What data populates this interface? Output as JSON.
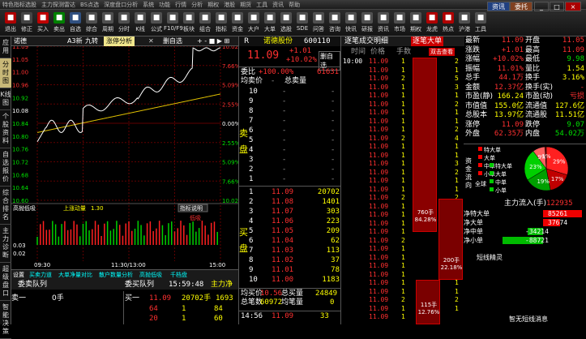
{
  "menu": [
    "特色指标选股",
    "主力探测雷达",
    "BS点选",
    "深度盘口分析",
    "系统",
    "功能",
    "行情",
    "分析",
    "期权",
    "港股",
    "期货",
    "工具",
    "资讯",
    "帮助"
  ],
  "toolbar": [
    {
      "label": "退出",
      "color": "#b00000"
    },
    {
      "label": "修正",
      "color": "#444"
    },
    {
      "label": "买入",
      "color": "#c00000"
    },
    {
      "label": "卖出",
      "color": "#008000"
    },
    {
      "label": "自选",
      "color": "#305080"
    },
    {
      "label": "综合",
      "color": "#505050"
    },
    {
      "label": "周期",
      "color": "#505050"
    },
    {
      "label": "分时",
      "color": "#505050"
    },
    {
      "label": "K线",
      "color": "#505050"
    },
    {
      "label": "公式",
      "color": "#505050"
    },
    {
      "label": "F10/F9",
      "color": "#505050"
    },
    {
      "label": "板块",
      "color": "#505050"
    },
    {
      "label": "组合",
      "color": "#505050"
    },
    {
      "label": "指标",
      "color": "#505050"
    },
    {
      "label": "资金",
      "color": "#505050"
    },
    {
      "label": "大户",
      "color": "#505050"
    },
    {
      "label": "大单",
      "color": "#505050"
    },
    {
      "label": "选股",
      "color": "#505050"
    },
    {
      "label": "SDE",
      "color": "#505050"
    },
    {
      "label": "问答",
      "color": "#505050"
    },
    {
      "label": "咨询",
      "color": "#505050"
    },
    {
      "label": "快讯",
      "color": "#505050"
    },
    {
      "label": "研报",
      "color": "#505050"
    },
    {
      "label": "资讯",
      "color": "#505050"
    },
    {
      "label": "市场",
      "color": "#505050"
    },
    {
      "label": "期权",
      "color": "#505050"
    },
    {
      "label": "龙虎",
      "color": "#b00000"
    },
    {
      "label": "热点",
      "color": "#b00000"
    },
    {
      "label": "沪港",
      "color": "#505050"
    },
    {
      "label": "工具",
      "color": "#505050"
    }
  ],
  "window": {
    "account": "资讯",
    "user": "委托",
    "min": "_",
    "max": "□",
    "close": "×"
  },
  "sidebar": [
    "应用",
    "分时图",
    "K线图",
    "个股资料",
    "自选报价",
    "综合排名",
    "主力诊断",
    "超级盘口",
    "智能决策"
  ],
  "chart_tabs": {
    "code": "诺德",
    "a": "A3新",
    "b": "九转",
    "active": "涨停分析",
    "close": "✕",
    "custom": "删自选",
    "controls": "+ - ■ ▶ ⊞"
  },
  "price_chart": {
    "left_ticks": [
      "11.09",
      "11.05",
      "11.00",
      "10.96",
      "10.92",
      "10.08",
      "10.84",
      "10.80",
      "10.76",
      "10.72",
      "10.68",
      "10.64",
      "10.60"
    ],
    "right_ticks": [
      "10.02%",
      "7.66%",
      "5.09%",
      "2.55%",
      "0.00%",
      "2.55%",
      "5.09%",
      "7.66%",
      "10.02%"
    ]
  },
  "indicator": {
    "title": "高抛低吸",
    "sub": "上涨动量",
    "value": "1.30",
    "btn": "指标说明",
    "mark": "低吸",
    "bottom_marks": [
      "0.03",
      "0.02"
    ]
  },
  "time_axis": [
    "09:30",
    "11:30/13:00",
    "15:00"
  ],
  "bottom_tabs": [
    "设置",
    "买卖力道",
    "大单净量对比",
    "散户数量分析",
    "高抛低吸",
    "千档盘"
  ],
  "queue": {
    "tab1": "委卖队列",
    "tab2": "委买队列",
    "time": "15:59:48",
    "right": "主力净",
    "left_label": "卖一",
    "left_value": "0手",
    "buy1_label": "买一",
    "buy1_price": "11.09",
    "buy1_vol": "20702手",
    "buy1_count": "1693",
    "rows": [
      [
        "64",
        "1",
        "84"
      ],
      [
        "20",
        "1",
        "60"
      ]
    ]
  },
  "quote": {
    "code": "R",
    "name": "诺德股份",
    "id": "600110",
    "price": "11.09",
    "change": "+1.01",
    "pct": "+10.02%",
    "btn": "删自选",
    "weibi_label": "委比",
    "weibi": "+100.00%",
    "weicha": "61631",
    "jun_label": "均卖价",
    "total_label": "总卖量",
    "sell": [
      [
        "10",
        "-",
        "-"
      ],
      [
        "9",
        "-",
        "-"
      ],
      [
        "8",
        "-",
        "-"
      ],
      [
        "7",
        "-",
        "-"
      ],
      [
        "6",
        "-",
        "-"
      ],
      [
        "5",
        "-",
        "-"
      ],
      [
        "4",
        "-",
        "-"
      ],
      [
        "3",
        "-",
        "-"
      ],
      [
        "2",
        "-",
        "-"
      ],
      [
        "1",
        "-",
        "-"
      ]
    ],
    "buy": [
      [
        "1",
        "11.09",
        "20702"
      ],
      [
        "2",
        "11.08",
        "1401"
      ],
      [
        "3",
        "11.07",
        "303"
      ],
      [
        "4",
        "11.06",
        "223"
      ],
      [
        "5",
        "11.05",
        "209"
      ],
      [
        "6",
        "11.04",
        "62"
      ],
      [
        "7",
        "11.03",
        "113"
      ],
      [
        "8",
        "11.02",
        "37"
      ],
      [
        "9",
        "11.01",
        "78"
      ],
      [
        "10",
        "11.00",
        "1183"
      ]
    ],
    "sell_side": "卖盘",
    "buy_side": "买盘",
    "avg_buy_label": "均买价",
    "avg_buy": "10.56",
    "total_buy_label": "总买量",
    "total_buy": "24849",
    "total_pen_label": "总笔数",
    "total_pen": "60972",
    "avg_pen_label": "均笔量",
    "avg_pen": "0",
    "tick_time": "14:56",
    "tick_price": "11.09",
    "tick_vol": "33"
  },
  "tape": {
    "tab1": "逐笔成交明细",
    "tab2": "逐笔大单",
    "cols": [
      "时间",
      "价格",
      "手数"
    ],
    "rows": [
      [
        "10:00",
        "11.09",
        "1"
      ],
      [
        "",
        "11.09",
        "1"
      ],
      [
        "",
        "11.09",
        "2"
      ],
      [
        "",
        "11.09",
        "1"
      ],
      [
        "",
        "11.09",
        "1"
      ],
      [
        "",
        "11.09",
        "1"
      ],
      [
        "",
        "11.09",
        "1"
      ],
      [
        "",
        "11.09",
        "1"
      ],
      [
        "",
        "11.09",
        "1"
      ],
      [
        "",
        "11.09",
        "2"
      ],
      [
        "",
        "11.09",
        "1"
      ],
      [
        "",
        "11.09",
        "1"
      ],
      [
        "",
        "11.09",
        "1"
      ],
      [
        "",
        "11.09",
        "1"
      ],
      [
        "",
        "11.09",
        "1"
      ],
      [
        "",
        "11.09",
        "1"
      ],
      [
        "",
        "11.09",
        "2"
      ],
      [
        "",
        "11.09",
        "1"
      ],
      [
        "",
        "11.09",
        "1"
      ],
      [
        "",
        "11.09",
        "1"
      ],
      [
        "",
        "11.09",
        "1"
      ],
      [
        "",
        "11.09",
        "2"
      ],
      [
        "",
        "11.09",
        "1"
      ],
      [
        "",
        "11.09",
        "1"
      ],
      [
        "",
        "11.09",
        "1"
      ],
      [
        "",
        "11.09",
        "1"
      ],
      [
        "",
        "11.09",
        "1"
      ],
      [
        "",
        "11.09",
        "1"
      ],
      [
        "",
        "11.09",
        "2"
      ],
      [
        "",
        "11.09",
        "1"
      ],
      [
        "",
        "11.09",
        "1"
      ]
    ],
    "right_rows": [
      "2",
      "1",
      "5",
      "3",
      "1",
      "2",
      "1",
      "1",
      "2",
      "4",
      "1",
      "1",
      "3",
      "2",
      "1",
      "1",
      "2",
      "3",
      "1",
      "1",
      "2",
      "1",
      "5",
      "1",
      "2",
      "3",
      "1",
      "1",
      "2",
      "1"
    ],
    "bars": [
      {
        "label": "760手",
        "pct": "84.28%"
      },
      {
        "label": "200手",
        "pct": "22.18%"
      },
      {
        "label": "115手",
        "pct": "12.76%"
      }
    ],
    "extra_tab": "双击查看",
    "extra_btn": "逐笔"
  },
  "stats": {
    "left": [
      [
        "最新",
        "11.09"
      ],
      [
        "涨跌",
        "+1.01"
      ],
      [
        "涨幅",
        "+10.02%"
      ],
      [
        "振幅",
        "11.01%"
      ],
      [
        "总手",
        "44.1万"
      ],
      [
        "金额",
        "12.37亿"
      ],
      [
        "市盈(静)",
        "166.24"
      ],
      [
        "市值值",
        "155.0亿"
      ],
      [
        "总股本",
        "13.97亿"
      ],
      [
        "涨停",
        "11.09"
      ],
      [
        "外盘",
        "62.35万"
      ]
    ],
    "right": [
      [
        "开盘",
        "11.05"
      ],
      [
        "最高",
        "11.09"
      ],
      [
        "最低",
        "9.98"
      ],
      [
        "量比",
        "1.54"
      ],
      [
        "换手",
        "3.16%"
      ],
      [
        "换手(实)",
        "-"
      ],
      [
        "市盈(动)",
        "亏损"
      ],
      [
        "流通值",
        "127.6亿"
      ],
      [
        "流通股",
        "11.51亿"
      ],
      [
        "跌停",
        "9.07"
      ],
      [
        "内盘",
        "54.02万"
      ]
    ]
  },
  "capital": {
    "title": "资金流向",
    "items": [
      "特大单",
      "大单",
      "中单",
      "小单",
      "特大单",
      "大单",
      "中单",
      "小单"
    ],
    "legend": "全球",
    "main_label": "主力流入(手)",
    "main_value": "122935",
    "rows": [
      [
        "净特大单",
        "85261"
      ],
      [
        "净大单",
        "37674"
      ],
      [
        "净中单",
        "-34214"
      ],
      [
        "净小单",
        "-88721"
      ]
    ],
    "rows_values": [
      85261,
      37674,
      -34214,
      -88721
    ],
    "pie": [
      {
        "label": "29%",
        "value": 29,
        "color": "#ff2020"
      },
      {
        "label": "17%",
        "value": 17,
        "color": "#c00000"
      },
      {
        "label": "19%",
        "value": 19,
        "color": "#00a000"
      },
      {
        "label": "23%",
        "value": 23,
        "color": "#00d000"
      },
      {
        "label": "9%",
        "value": 9,
        "color": "#ff6060"
      },
      {
        "label": "1%",
        "value": 1,
        "color": "#800000"
      }
    ],
    "footer": "短线精灵",
    "footer2": "智无短线消息"
  }
}
